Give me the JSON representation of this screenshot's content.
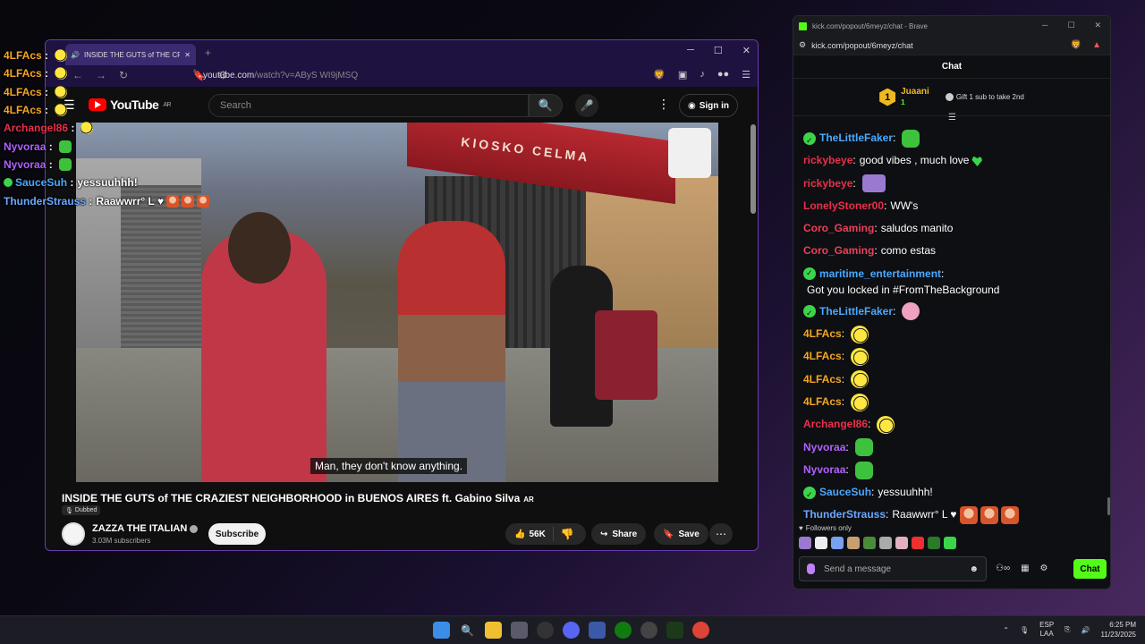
{
  "overlay_chat": [
    {
      "user": "4LFAcs",
      "color": "#f5a623",
      "text": "",
      "emotes": [
        "bee"
      ],
      "badge": false
    },
    {
      "user": "4LFAcs",
      "color": "#f5a623",
      "text": "",
      "emotes": [
        "bee"
      ],
      "badge": false
    },
    {
      "user": "4LFAcs",
      "color": "#f5a623",
      "text": "",
      "emotes": [
        "bee"
      ],
      "badge": false
    },
    {
      "user": "4LFAcs",
      "color": "#f5a623",
      "text": "",
      "emotes": [
        "bee"
      ],
      "badge": false
    },
    {
      "user": "Archangel86",
      "color": "#e8304a",
      "text": "",
      "emotes": [
        "bee"
      ],
      "badge": false
    },
    {
      "user": "Nyvoraa",
      "color": "#b060ff",
      "text": "",
      "emotes": [
        "green"
      ],
      "badge": false
    },
    {
      "user": "Nyvoraa",
      "color": "#b060ff",
      "text": "",
      "emotes": [
        "green"
      ],
      "badge": false
    },
    {
      "user": "SauceSuh",
      "color": "#4aa8ff",
      "text": "yessuuhhh!",
      "emotes": [],
      "badge": true
    },
    {
      "user": "ThunderStrauss",
      "color": "#6aa8ff",
      "text": "Raawwrr° L ♥",
      "emotes": [
        "girl",
        "girl",
        "girl"
      ],
      "badge": false
    }
  ],
  "browser": {
    "tab_title": "INSIDE THE GUTS of THE CRAZ",
    "url_host": "youtube.com",
    "url_path": "/watch?v=AByS WI9jMSQ"
  },
  "youtube": {
    "logo": "YouTube",
    "logo_region": "AR",
    "search_placeholder": "Search",
    "sign_in": "Sign in",
    "video": {
      "caption": "Man, they don't know anything.",
      "storefront": "KIOSKO CELMA"
    },
    "title": "INSIDE THE GUTS of THE CRAZIEST NEIGHBORHOOD in BUENOS AIRES ft. Gabino Silva",
    "title_badge": "AR",
    "dubbed": "Dubbed",
    "channel": "ZAZZA THE ITALIAN",
    "subscribers": "3.03M subscribers",
    "subscribe": "Subscribe",
    "likes": "56K",
    "share": "Share",
    "save": "Save"
  },
  "kick": {
    "window_title": "kick.com/popout/6meyz/chat - Brave",
    "url": "kick.com/popout/6meyz/chat",
    "chat_header": "Chat",
    "gift": {
      "rank": "1",
      "user": "Juaani",
      "count": "1",
      "text": "Gift 1 sub to take 2nd"
    },
    "messages": [
      {
        "user": "TheLittleFaker",
        "color": "#4aa8ff",
        "badge": true,
        "text": "",
        "emotes": [
          "green"
        ]
      },
      {
        "user": "rickybeye",
        "color": "#e8304a",
        "badge": false,
        "text": "good vibes , much love",
        "emotes": [
          "heart"
        ]
      },
      {
        "user": "rickybeye",
        "color": "#e8304a",
        "badge": false,
        "text": "",
        "emotes": [
          "lurk"
        ]
      },
      {
        "user": "LonelyStoner00",
        "color": "#e8304a",
        "badge": false,
        "text": "WW's",
        "emotes": []
      },
      {
        "user": "Coro_Gaming",
        "color": "#e8405a",
        "badge": false,
        "text": "saludos manito",
        "emotes": []
      },
      {
        "user": "Coro_Gaming",
        "color": "#e8405a",
        "badge": false,
        "text": "como estas",
        "emotes": []
      },
      {
        "user": "maritime_entertainment",
        "color": "#4aa8ff",
        "badge": true,
        "text": "Got you locked in #FromTheBackground",
        "emotes": [],
        "multi": true
      },
      {
        "user": "TheLittleFaker",
        "color": "#4aa8ff",
        "badge": true,
        "text": "",
        "emotes": [
          "pink"
        ]
      },
      {
        "user": "4LFAcs",
        "color": "#f5a623",
        "badge": false,
        "text": "",
        "emotes": [
          "bee"
        ]
      },
      {
        "user": "4LFAcs",
        "color": "#f5a623",
        "badge": false,
        "text": "",
        "emotes": [
          "bee"
        ]
      },
      {
        "user": "4LFAcs",
        "color": "#f5a623",
        "badge": false,
        "text": "",
        "emotes": [
          "bee"
        ]
      },
      {
        "user": "4LFAcs",
        "color": "#f5a623",
        "badge": false,
        "text": "",
        "emotes": [
          "bee"
        ]
      },
      {
        "user": "Archangel86",
        "color": "#e8304a",
        "badge": false,
        "text": "",
        "emotes": [
          "bee"
        ]
      },
      {
        "user": "Nyvoraa",
        "color": "#b060ff",
        "badge": false,
        "text": "",
        "emotes": [
          "green"
        ]
      },
      {
        "user": "Nyvoraa",
        "color": "#b060ff",
        "badge": false,
        "text": "",
        "emotes": [
          "green"
        ]
      },
      {
        "user": "SauceSuh",
        "color": "#4aa8ff",
        "badge": true,
        "text": "yessuuhhh!",
        "emotes": []
      },
      {
        "user": "ThunderStrauss",
        "color": "#6aa8ff",
        "badge": false,
        "text": "Raawwrr° L ♥",
        "emotes": [
          "girl",
          "girl",
          "girl"
        ]
      }
    ],
    "followers_only": "Followers only",
    "input_placeholder": "Send a message",
    "send": "Chat"
  },
  "taskbar": {
    "lang_top": "ESP",
    "lang_bottom": "LAA",
    "time": "6:25 PM",
    "date": "11/23/2025"
  }
}
